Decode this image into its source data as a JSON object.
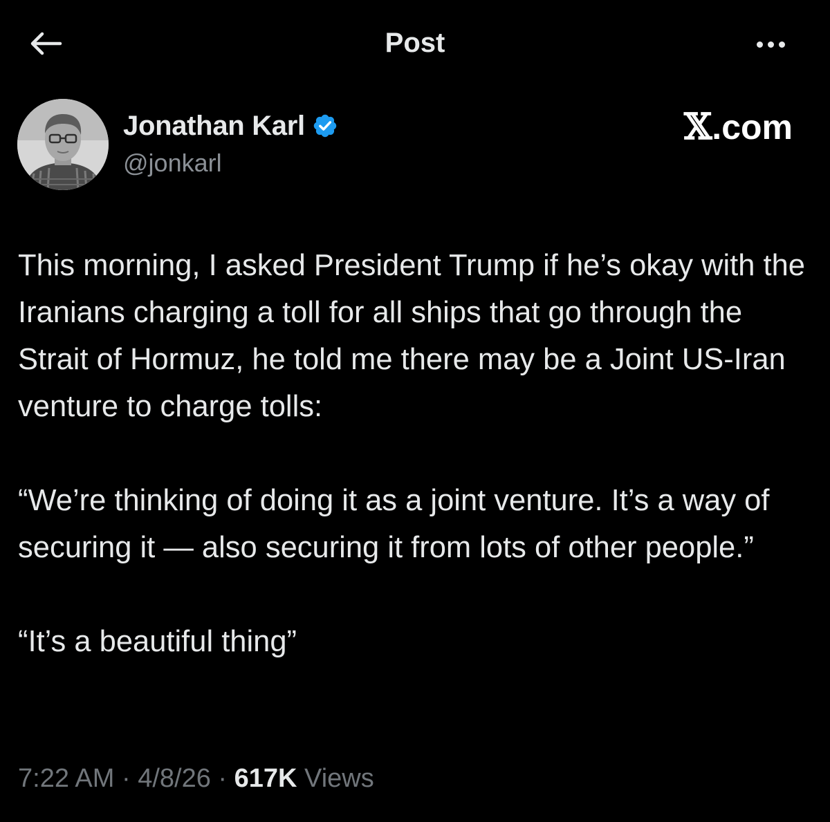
{
  "header": {
    "title": "Post",
    "back_icon": "arrow-left-icon",
    "more_icon": "more-horizontal-icon"
  },
  "author": {
    "name": "Jonathan Karl",
    "handle": "@jonkarl",
    "verified": true,
    "verified_color": "#1d9bf0",
    "verified_icon": "verified-badge-icon"
  },
  "brand": {
    "glyph": "𝕏",
    "suffix": ".com"
  },
  "tweet": {
    "paragraphs": [
      "This morning, I asked President Trump if he’s okay with the Iranians charging a toll for all ships that go through the Strait of Hormuz, he told me there may be a Joint US-Iran venture to charge tolls:",
      "“We’re thinking of doing it as a joint venture. It’s a way of securing it — also securing it from lots of other people.”",
      "“It’s a beautiful thing”"
    ]
  },
  "meta": {
    "time": "7:22 AM",
    "separator": "·",
    "date": "4/8/26",
    "views_count": "617K",
    "views_label": "Views"
  },
  "colors": {
    "background": "#000000",
    "text_primary": "#e7e9ea",
    "text_secondary": "#71767b",
    "accent": "#1d9bf0"
  }
}
